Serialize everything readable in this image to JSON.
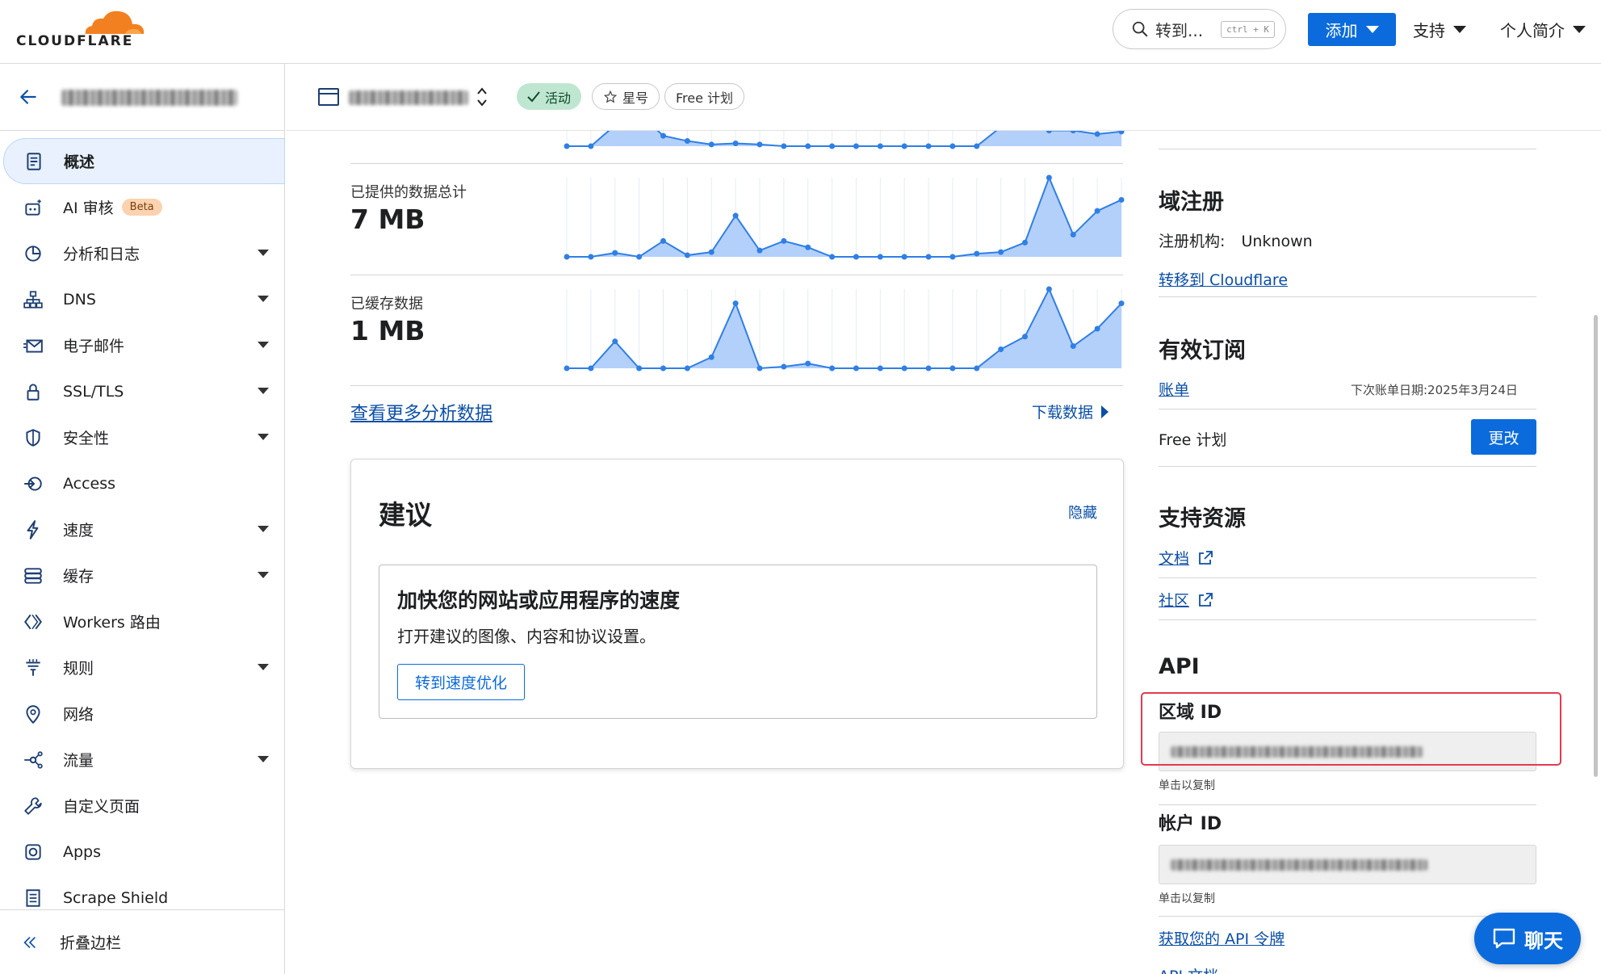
{
  "brand": {
    "name": "CLOUDFLARE",
    "accent": "#f38020",
    "primary": "#0b6bdc"
  },
  "header": {
    "search_label": "转到...",
    "search_shortcut": "ctrl + K",
    "add_label": "添加",
    "support_label": "支持",
    "profile_label": "个人简介"
  },
  "zone": {
    "status": "活动",
    "star_label": "星号",
    "plan_label": "Free 计划"
  },
  "sidebar": {
    "items": [
      {
        "label": "概述",
        "icon": "document-icon",
        "active": true,
        "has_caret": false
      },
      {
        "label": "AI 审核",
        "icon": "ai-audit-icon",
        "badge": "Beta",
        "has_caret": false
      },
      {
        "label": "分析和日志",
        "icon": "pie-chart-icon",
        "has_caret": true
      },
      {
        "label": "DNS",
        "icon": "network-tree-icon",
        "has_caret": true
      },
      {
        "label": "电子邮件",
        "icon": "envelope-icon",
        "has_caret": true
      },
      {
        "label": "SSL/TLS",
        "icon": "lock-icon",
        "has_caret": true
      },
      {
        "label": "安全性",
        "icon": "shield-icon",
        "has_caret": true
      },
      {
        "label": "Access",
        "icon": "access-icon",
        "has_caret": false
      },
      {
        "label": "速度",
        "icon": "lightning-icon",
        "has_caret": true
      },
      {
        "label": "缓存",
        "icon": "storage-icon",
        "has_caret": true
      },
      {
        "label": "Workers 路由",
        "icon": "workers-icon",
        "has_caret": false
      },
      {
        "label": "规则",
        "icon": "funnel-icon",
        "has_caret": true
      },
      {
        "label": "网络",
        "icon": "location-pin-icon",
        "has_caret": false
      },
      {
        "label": "流量",
        "icon": "traffic-icon",
        "has_caret": true
      },
      {
        "label": "自定义页面",
        "icon": "wrench-icon",
        "has_caret": false
      },
      {
        "label": "Apps",
        "icon": "apps-icon",
        "has_caret": false
      },
      {
        "label": "Scrape Shield",
        "icon": "scrape-shield-icon",
        "has_caret": false
      }
    ],
    "collapse_label": "折叠边栏"
  },
  "analytics": {
    "metrics": [
      {
        "label": "已提供的数据总计",
        "value": "7 MB"
      },
      {
        "label": "已缓存数据",
        "value": "1 MB"
      }
    ],
    "more_link": "查看更多分析数据",
    "download_label": "下载数据"
  },
  "chart_data": [
    {
      "type": "area",
      "title": "已提供的数据总计",
      "y_norm": [
        0.0,
        0.0,
        0.05,
        0.0,
        0.2,
        0.02,
        0.06,
        0.52,
        0.08,
        0.2,
        0.12,
        0.0,
        0.0,
        0.0,
        0.0,
        0.0,
        0.0,
        0.04,
        0.06,
        0.18,
        1.0,
        0.28,
        0.58,
        0.72
      ]
    },
    {
      "type": "area",
      "title": "已缓存数据",
      "y_norm": [
        0.0,
        0.0,
        0.34,
        0.0,
        0.0,
        0.0,
        0.14,
        0.82,
        0.0,
        0.02,
        0.06,
        0.0,
        0.0,
        0.0,
        0.0,
        0.0,
        0.0,
        0.0,
        0.24,
        0.4,
        1.0,
        0.28,
        0.5,
        0.82
      ]
    },
    {
      "type": "area",
      "title": "",
      "y_norm": [
        0.0,
        0.0,
        0.6,
        0.95,
        0.3,
        0.15,
        0.05,
        0.08,
        0.05,
        0.0,
        0.0,
        0.0,
        0.0,
        0.0,
        0.0,
        0.0,
        0.0,
        0.0,
        0.55,
        0.8,
        0.45,
        0.45,
        0.35,
        0.42
      ]
    }
  ],
  "suggestions": {
    "title": "建议",
    "hide_label": "隐藏",
    "item_title": "加快您的网站或应用程序的速度",
    "item_desc": "打开建议的图像、内容和协议设置。",
    "item_button": "转到速度优化"
  },
  "right": {
    "domain_reg": {
      "title": "域注册",
      "registrar_label": "注册机构:",
      "registrar_value": "Unknown",
      "transfer_link": "转移到 Cloudflare"
    },
    "subscriptions": {
      "title": "有效订阅",
      "billing_link": "账单",
      "next_bill": "下次账单日期:2025年3月24日",
      "plan": "Free 计划",
      "change_label": "更改"
    },
    "support": {
      "title": "支持资源",
      "docs_link": "文档",
      "community_link": "社区"
    },
    "api": {
      "title": "API",
      "zone_id_label": "区域 ID",
      "account_id_label": "帐户 ID",
      "click_copy": "单击以复制",
      "token_link": "获取您的 API 令牌",
      "docs_link": "API 文档"
    }
  },
  "chat_label": "聊天"
}
